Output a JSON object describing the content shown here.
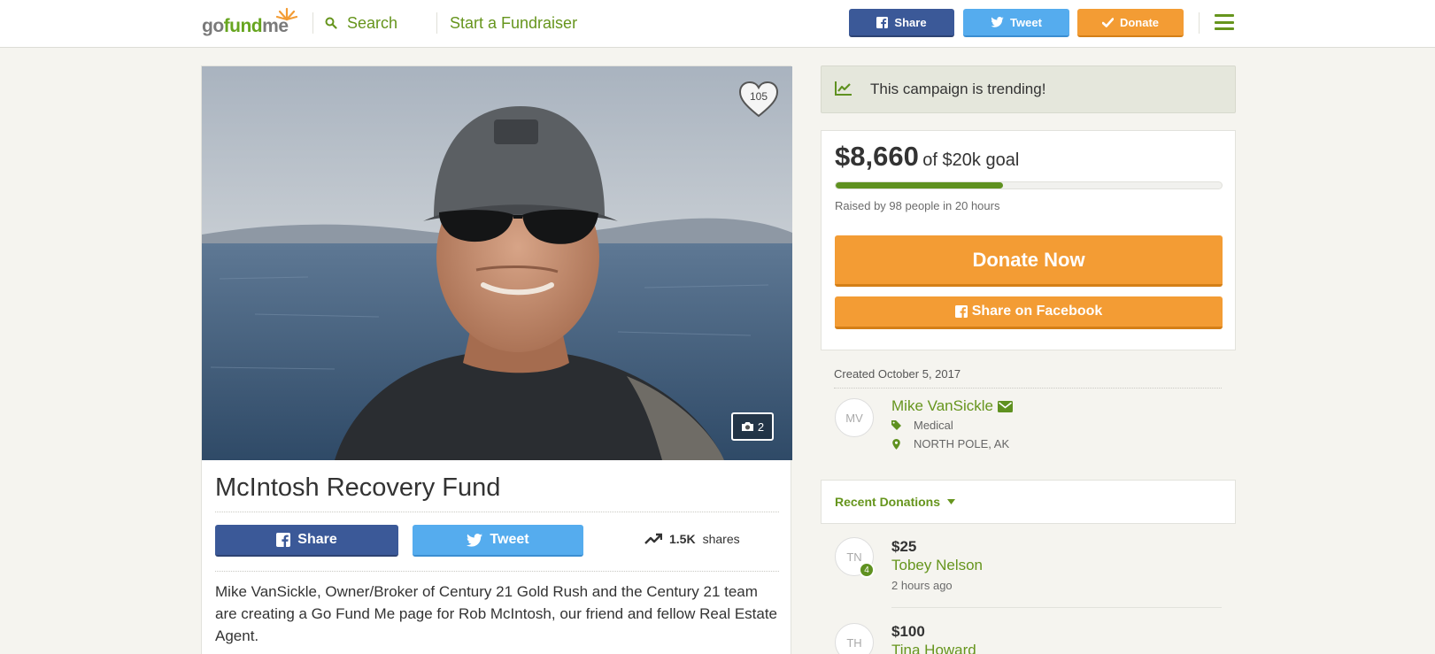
{
  "header": {
    "logo": {
      "part1": "go",
      "part2": "fund",
      "part3": "me"
    },
    "search_label": "Search",
    "start_fundraiser_label": "Start a Fundraiser",
    "share_label": "Share",
    "tweet_label": "Tweet",
    "donate_label": "Donate"
  },
  "campaign": {
    "title": "McIntosh Recovery Fund",
    "heart_count": "105",
    "photo_count": "2",
    "share_label": "Share",
    "tweet_label": "Tweet",
    "shares_count": "1.5K",
    "shares_label": "shares",
    "story": "Mike VanSickle, Owner/Broker of Century 21 Gold Rush and the Century 21 team are creating a Go Fund Me page for Rob McIntosh, our friend and fellow Real Estate Agent."
  },
  "trending": {
    "text": "This campaign is trending!"
  },
  "donation_summary": {
    "raised": "$8,660",
    "goal_text": "of $20k goal",
    "progress_fraction": 0.433,
    "raised_by": "Raised by 98 people in 20 hours",
    "donate_now_label": "Donate Now",
    "share_facebook_label": "Share on Facebook"
  },
  "organizer": {
    "created": "Created October 5, 2017",
    "initials": "MV",
    "name": "Mike VanSickle",
    "category": "Medical",
    "location": "NORTH POLE, AK"
  },
  "recent_donations": {
    "label": "Recent Donations",
    "items": [
      {
        "initials": "TN",
        "badge": "4",
        "amount": "$25",
        "name": "Tobey Nelson",
        "time": "2 hours ago"
      },
      {
        "initials": "TH",
        "amount": "$100",
        "name": "Tina Howard"
      }
    ]
  },
  "colors": {
    "brand_green": "#66951d",
    "facebook_blue": "#3b5998",
    "twitter_blue": "#55acee",
    "donate_orange": "#f39c34"
  }
}
